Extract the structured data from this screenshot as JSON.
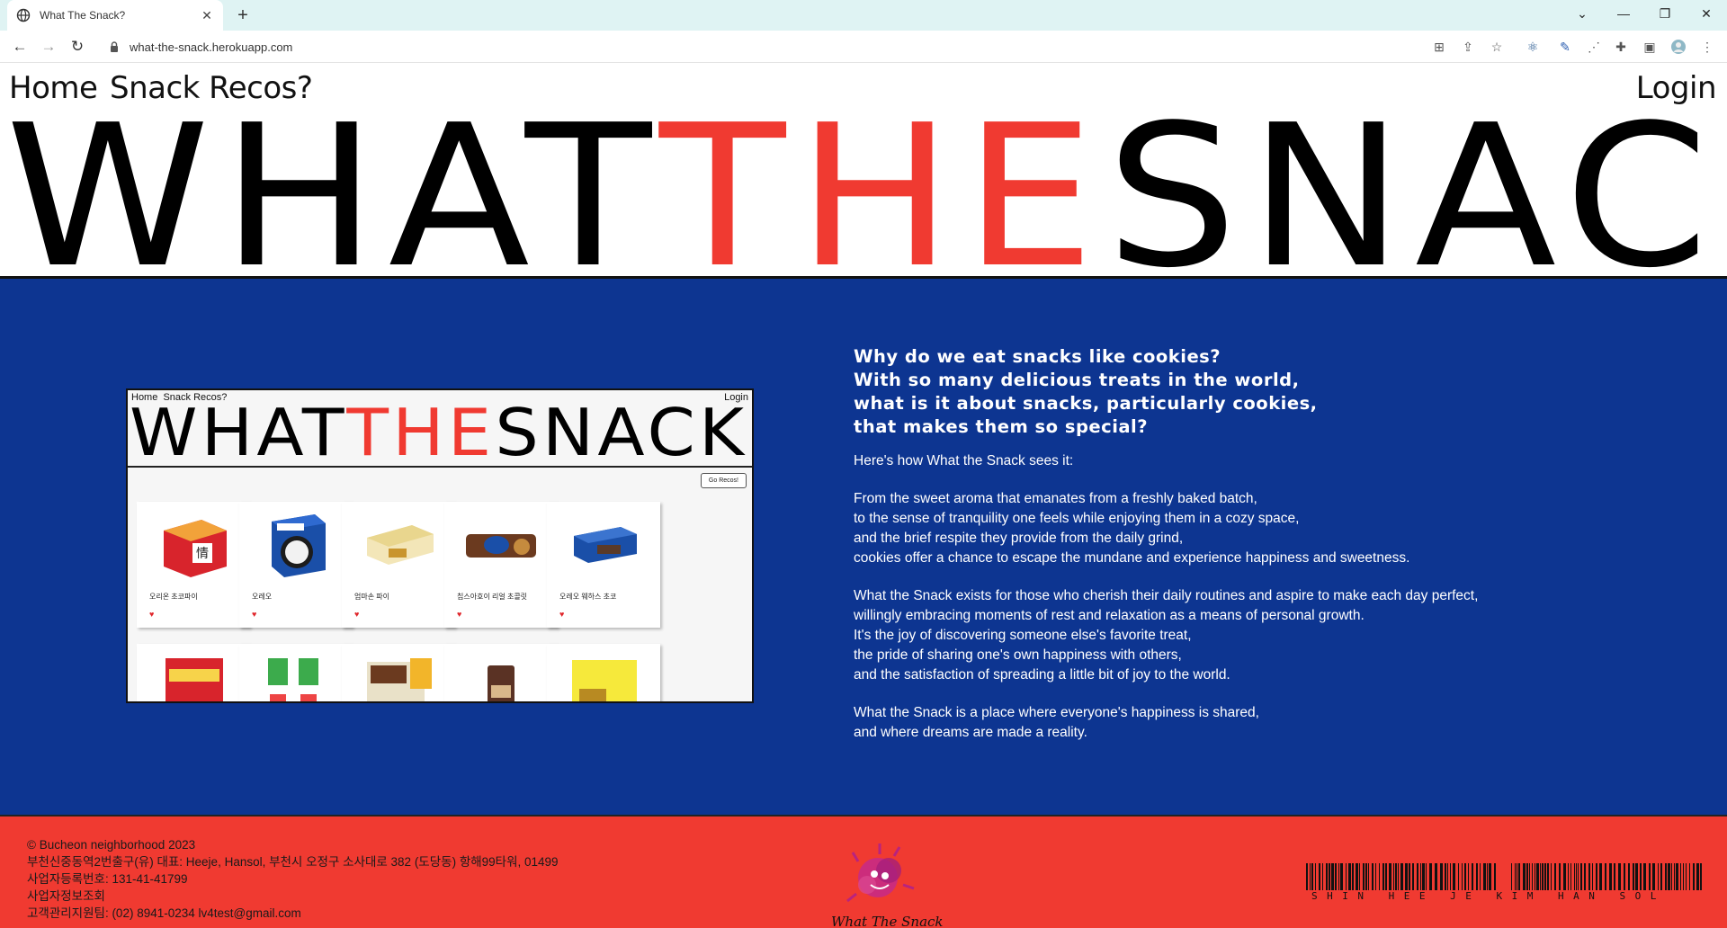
{
  "browser": {
    "tab_title": "What The Snack?",
    "url": "what-the-snack.herokuapp.com"
  },
  "nav": {
    "home": "Home",
    "recos": "Snack Recos?",
    "login": "Login"
  },
  "hero": {
    "part1": "WHAT",
    "part2": "THE",
    "part3": "SNACK",
    "accent_color": "#f03a31"
  },
  "preview": {
    "nav_home": "Home",
    "nav_recos": "Snack Recos?",
    "nav_login": "Login",
    "hero1": "WHAT",
    "hero2": "THE",
    "hero3": "SNACK",
    "button": "Go Recos!",
    "cards": [
      {
        "name": "오리온 초코파이"
      },
      {
        "name": "오레오"
      },
      {
        "name": "엄마손 파이"
      },
      {
        "name": "칩스아호이 리얼 초콜릿"
      },
      {
        "name": "오레오 웨하스 초코"
      }
    ]
  },
  "about": {
    "heading": "Why do we eat snacks like cookies?\nWith so many delicious treats in the world,\nwhat is it about snacks, particularly cookies,\nthat makes them so special?",
    "p1": "Here's how What the Snack sees it:",
    "p2": "From the sweet aroma that emanates from a freshly baked batch,\nto the sense of tranquility one feels while enjoying them in a cozy space,\nand the brief respite they provide from the daily grind,\ncookies offer a chance to escape the mundane and experience happiness and sweetness.",
    "p3": "What the Snack exists for those who cherish their daily routines and aspire to make each day perfect,\nwillingly embracing moments of rest and relaxation as a means of personal growth.\nIt's the joy of discovering someone else's favorite treat,\nthe pride of sharing one's own happiness with others,\nand the satisfaction of spreading a little bit of joy to the world.",
    "p4": "What the Snack is a place where everyone's happiness is shared,\nand where dreams are made a reality."
  },
  "footer": {
    "line1": "© Bucheon neighborhood 2023",
    "line2": "부천신중동역2번출구(유) 대표: Heeje, Hansol, 부천시 오정구 소사대로 382 (도당동) 항해99타워, 01499",
    "line3": "사업자등록번호: 131-41-41799",
    "line4": "사업자정보조회",
    "line5": "고객관리지원팀: (02) 8941-0234 lv4test@gmail.com",
    "logo_text": "What The Snack",
    "barcode_text": "SHIN HEE JE KIM HAN SOL",
    "background": "#f03a31"
  },
  "colors": {
    "blue_section": "#0d3591"
  }
}
